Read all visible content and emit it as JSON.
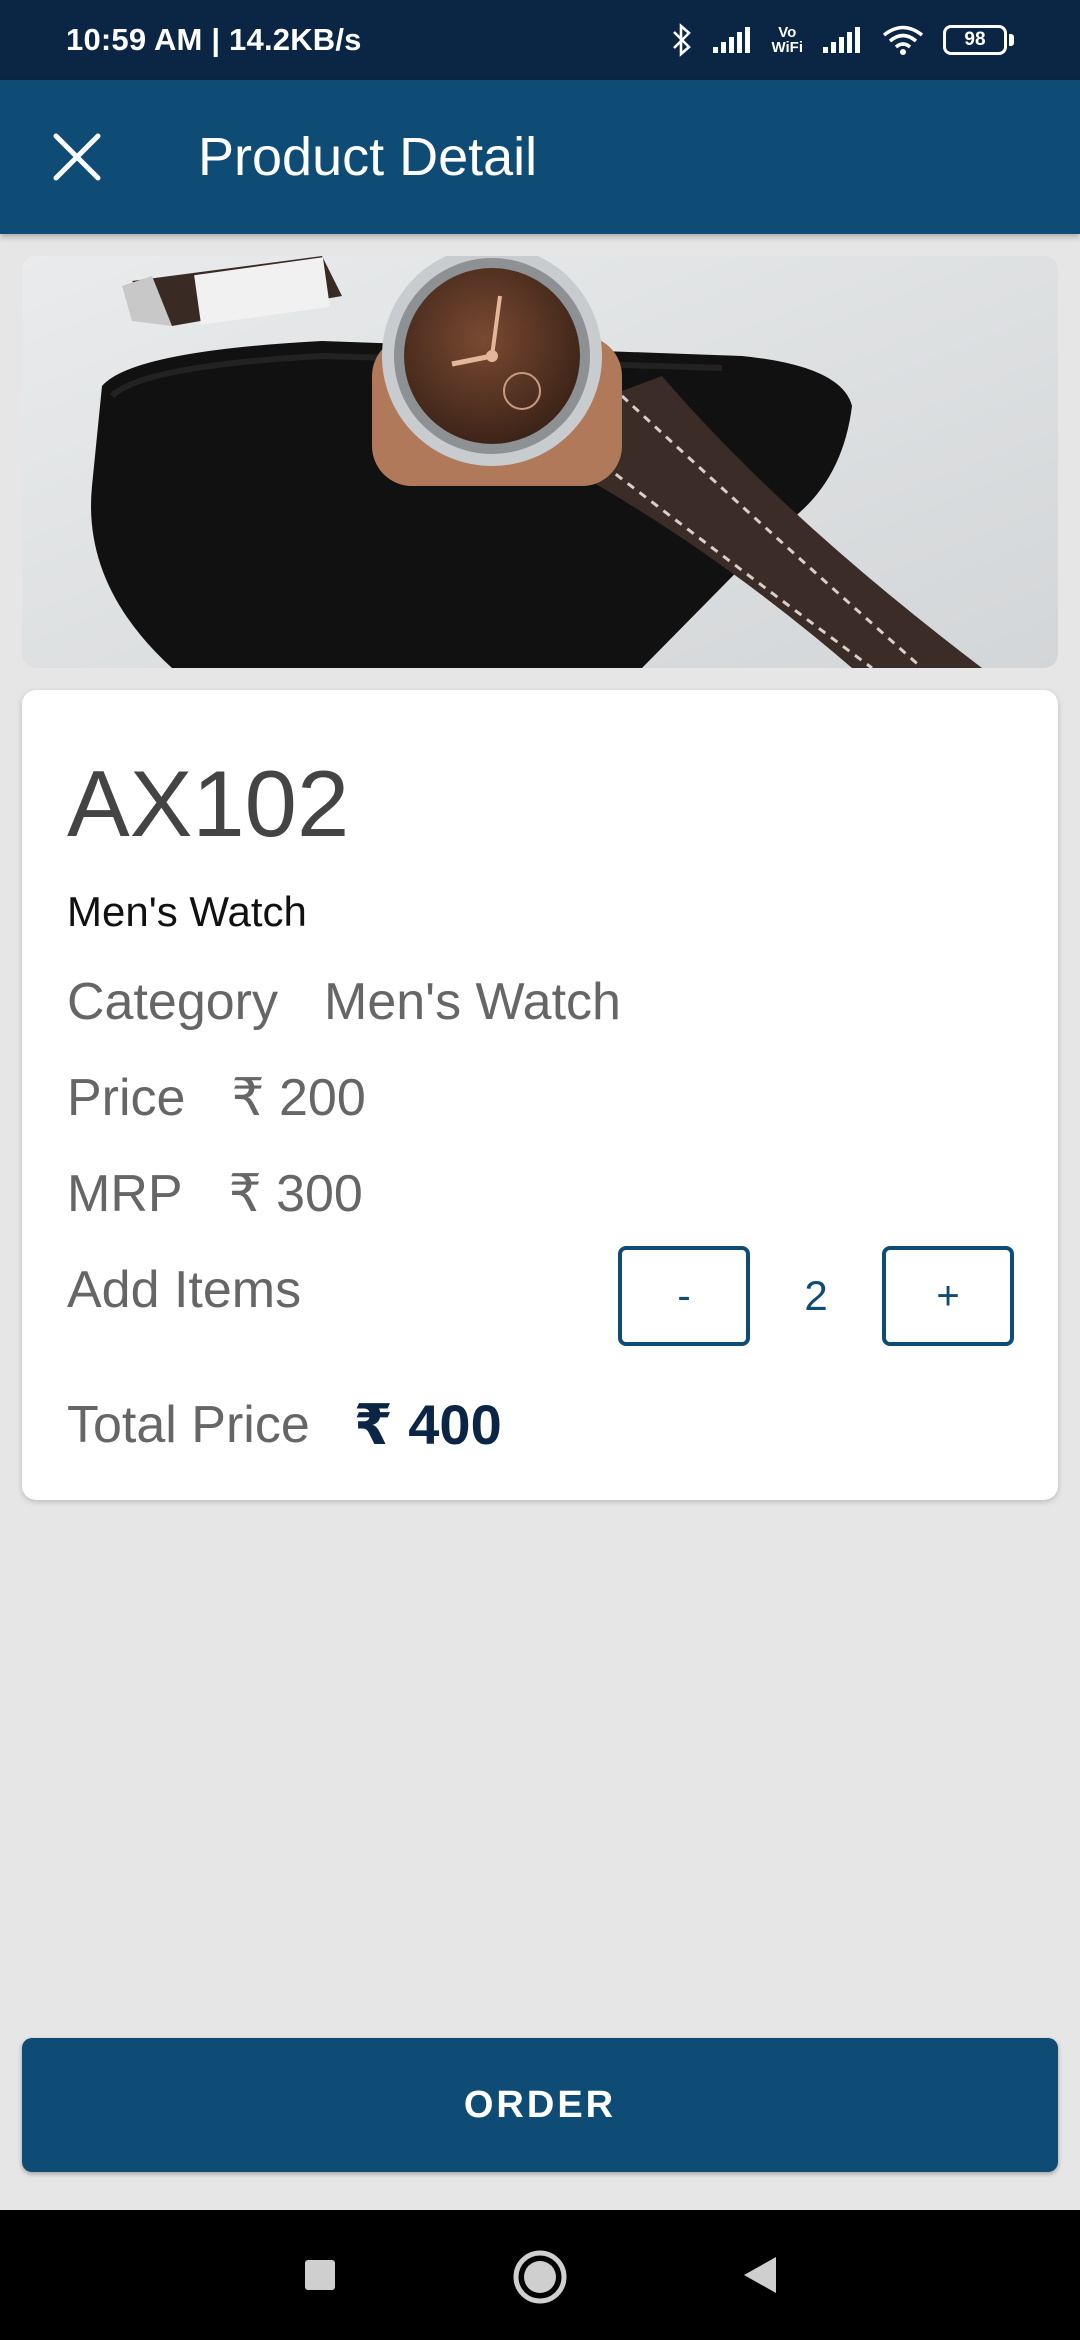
{
  "status_bar": {
    "time_speed": "10:59 AM | 14.2KB/s",
    "vowifi_label_top": "Vo",
    "vowifi_label_bottom": "WiFi",
    "battery": "98"
  },
  "app_bar": {
    "title": "Product Detail",
    "close_icon": "close-icon"
  },
  "product": {
    "image_icon": "watch-photo",
    "code": "AX102",
    "name": "Men's Watch",
    "category_label": "Category",
    "category_value": "Men's Watch",
    "price_label": "Price",
    "price_value": "₹ 200",
    "mrp_label": "MRP",
    "mrp_value": "₹ 300",
    "add_items_label": "Add Items",
    "decrement_label": "-",
    "quantity": "2",
    "increment_label": "+",
    "total_label": "Total Price",
    "total_value": "₹ 400"
  },
  "order_button": {
    "label": "ORDER"
  },
  "nav_bar": {
    "recent_icon": "square-icon",
    "home_icon": "circle-icon",
    "back_icon": "triangle-back-icon"
  },
  "colors": {
    "status_bar": "#0b2545",
    "primary": "#0f4c75",
    "background": "#e6e6e6",
    "total_text": "#0b2545"
  }
}
